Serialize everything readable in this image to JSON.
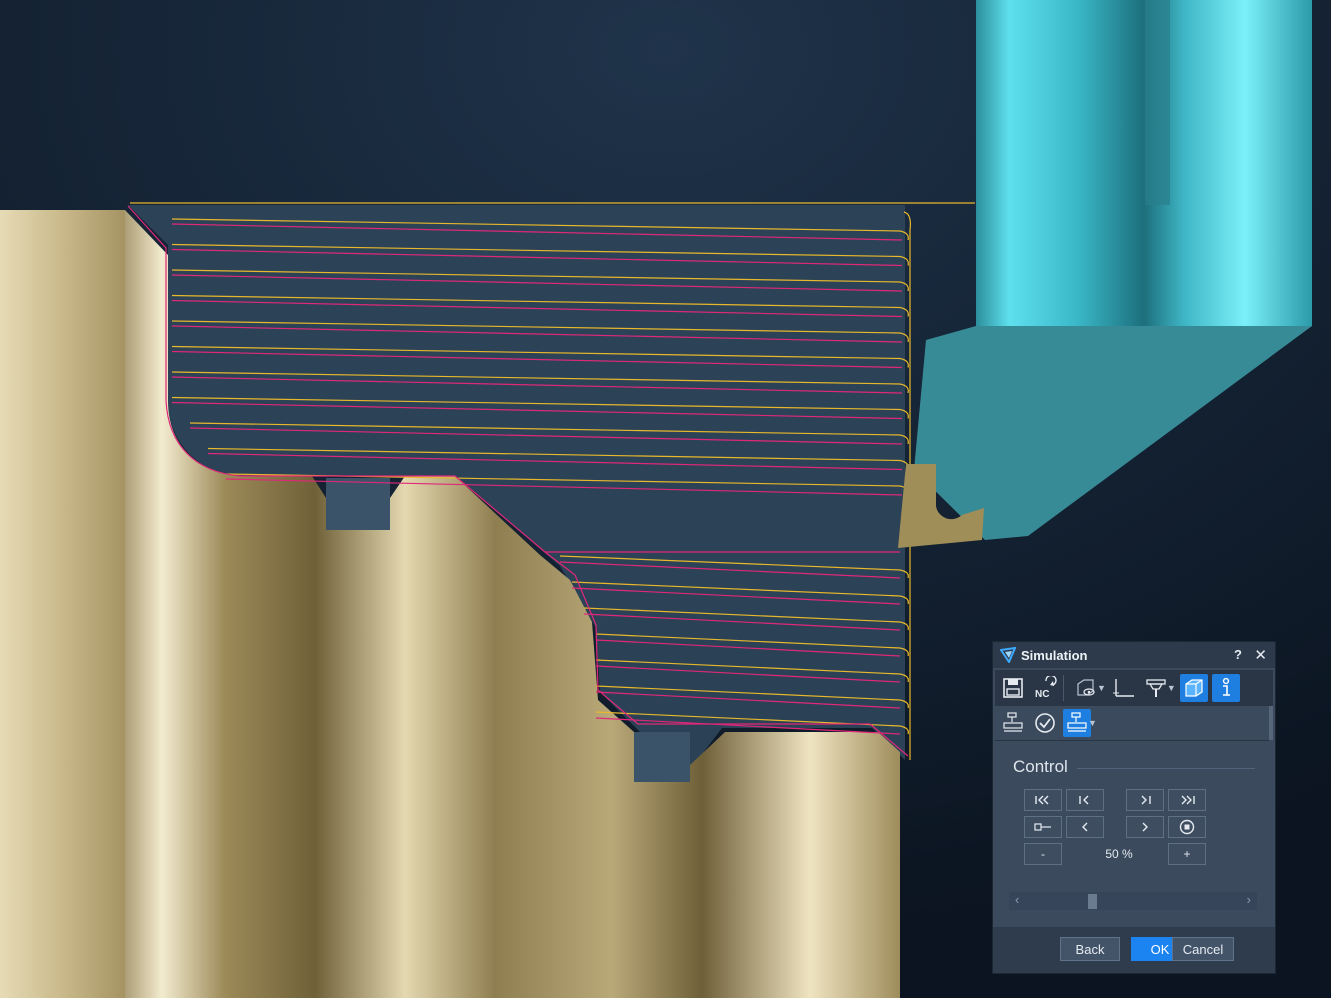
{
  "dialog": {
    "title": "Simulation",
    "help_label": "?",
    "close_label": "✕",
    "toolbar_icons": [
      "save-icon",
      "nc-icon",
      "view-stock-icon",
      "dimension-icon",
      "tool-display-icon",
      "solid-view-icon",
      "info-icon"
    ],
    "nc_label": "NC",
    "control_section_title": "Control",
    "speed_value": "50 %",
    "speed_minus": "-",
    "speed_plus": "+",
    "slider_position": 0.3,
    "buttons": {
      "back": "Back",
      "ok": "OK",
      "cancel": "Cancel"
    }
  },
  "colors": {
    "background": "#0d1724",
    "stock": "#c9b98a",
    "tool_cyan": "#2ea3b3",
    "toolpath_magenta": "#e0287a",
    "toolpath_yellow": "#e8b82c",
    "accent_blue": "#1b84f0"
  }
}
